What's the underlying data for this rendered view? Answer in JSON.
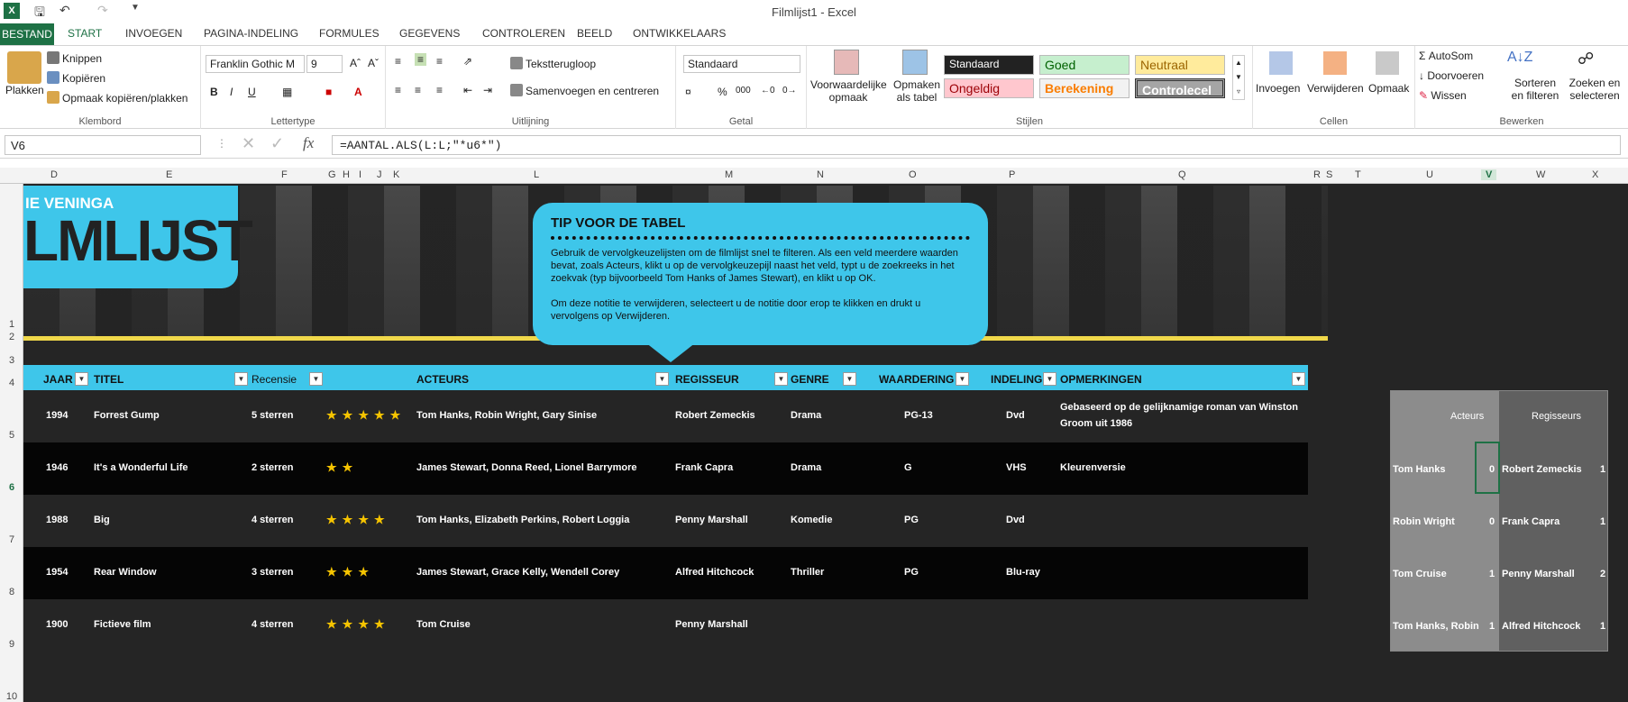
{
  "window": {
    "title": "Filmlijst1 - Excel"
  },
  "tabs": [
    {
      "label": "BESTAND"
    },
    {
      "label": "START"
    },
    {
      "label": "INVOEGEN"
    },
    {
      "label": "PAGINA-INDELING"
    },
    {
      "label": "FORMULES"
    },
    {
      "label": "GEGEVENS"
    },
    {
      "label": "CONTROLEREN"
    },
    {
      "label": "BEELD"
    },
    {
      "label": "ONTWIKKELAARS"
    }
  ],
  "ribbon": {
    "clipboard": {
      "paste": "Plakken",
      "cut": "Knippen",
      "copy": "Kopiëren",
      "format_painter": "Opmaak kopiëren/plakken",
      "label": "Klembord"
    },
    "font": {
      "name": "Franklin Gothic M",
      "size": "9",
      "bold": "B",
      "italic": "I",
      "underline": "U",
      "label": "Lettertype"
    },
    "alignment": {
      "wrap": "Tekstterugloop",
      "merge": "Samenvoegen en centreren",
      "label": "Uitlijning"
    },
    "number": {
      "format": "Standaard",
      "percent": "%",
      "thousands": "000",
      "label": "Getal"
    },
    "styles": {
      "conditional": "Voorwaardelijke opmaak",
      "as_table": "Opmaken als tabel",
      "cells": [
        {
          "text": "Standaard",
          "bg": "#222222",
          "fg": "#ffffff"
        },
        {
          "text": "Goed",
          "bg": "#c6efce",
          "fg": "#006100"
        },
        {
          "text": "Neutraal",
          "bg": "#ffeb9c",
          "fg": "#9c6500"
        },
        {
          "text": "Ongeldig",
          "bg": "#ffc7ce",
          "fg": "#9c0006"
        },
        {
          "text": "Berekening",
          "bg": "#f2f2f2",
          "fg": "#fa7d00"
        },
        {
          "text": "Controlecel",
          "bg": "#a5a5a5",
          "fg": "#ffffff"
        }
      ],
      "label": "Stijlen"
    },
    "cells": {
      "insert": "Invoegen",
      "delete": "Verwijderen",
      "format": "Opmaak",
      "label": "Cellen"
    },
    "editing": {
      "autosum": "AutoSom",
      "fill": "Doorvoeren",
      "clear": "Wissen",
      "sort": "Sorteren en filteren",
      "find": "Zoeken en selecteren",
      "label": "Bewerken"
    }
  },
  "formula_bar": {
    "name_box": "V6",
    "fx": "fx",
    "formula": "=AANTAL.ALS(L:L;\"*u6*\")"
  },
  "columns": [
    "D",
    "E",
    "F",
    "G",
    "H",
    "I",
    "J",
    "K",
    "L",
    "M",
    "N",
    "O",
    "P",
    "Q",
    "R",
    "S",
    "T",
    "U",
    "V",
    "W",
    "X"
  ],
  "rows": [
    "1",
    "2",
    "3",
    "4",
    "5",
    "6",
    "7",
    "8",
    "9",
    "10"
  ],
  "banner": {
    "line1": "IE VENINGA",
    "line2": "LMLIJST"
  },
  "tip": {
    "title": "TIP VOOR DE TABEL",
    "p1": "Gebruik de vervolgkeuzelijsten om de filmlijst snel te filteren. Als een veld meerdere waarden bevat, zoals Acteurs, klikt u op de vervolgkeuzepijl naast het veld, typt u de zoekreeks in het zoekvak (typ bijvoorbeeld Tom Hanks of James Stewart), en klikt u op OK.",
    "p2": "Om deze notitie te verwijderen, selecteert u de notitie door erop te klikken en drukt u vervolgens op Verwijderen."
  },
  "table": {
    "headers": {
      "year": "JAAR",
      "title": "TITEL",
      "review": "Recensie",
      "actors": "ACTEURS",
      "director": "REGISSEUR",
      "genre": "GENRE",
      "rating": "WAARDERING",
      "format": "INDELING",
      "notes": "OPMERKINGEN"
    },
    "rows": [
      {
        "year": "1994",
        "title": "Forrest Gump",
        "review": "5 sterren",
        "stars": 5,
        "actors": "Tom Hanks, Robin Wright, Gary Sinise",
        "director": "Robert Zemeckis",
        "genre": "Drama",
        "rating": "PG-13",
        "format": "Dvd",
        "notes": "Gebaseerd op de gelijknamige roman van Winston",
        "notes2": "Groom uit 1986"
      },
      {
        "year": "1946",
        "title": "It's a Wonderful Life",
        "review": "2 sterren",
        "stars": 2,
        "actors": "James Stewart, Donna Reed, Lionel Barrymore",
        "director": "Frank Capra",
        "genre": "Drama",
        "rating": "G",
        "format": "VHS",
        "notes": "Kleurenversie",
        "notes2": ""
      },
      {
        "year": "1988",
        "title": "Big",
        "review": "4 sterren",
        "stars": 4,
        "actors": "Tom Hanks, Elizabeth Perkins, Robert Loggia",
        "director": "Penny Marshall",
        "genre": "Komedie",
        "rating": "PG",
        "format": "Dvd",
        "notes": "",
        "notes2": ""
      },
      {
        "year": "1954",
        "title": "Rear Window",
        "review": "3 sterren",
        "stars": 3,
        "actors": "James Stewart, Grace Kelly, Wendell Corey",
        "director": "Alfred Hitchcock",
        "genre": "Thriller",
        "rating": "PG",
        "format": "Blu-ray",
        "notes": "",
        "notes2": ""
      },
      {
        "year": "1900",
        "title": "Fictieve film",
        "review": "4 sterren",
        "stars": 4,
        "actors": "Tom Cruise",
        "director": "Penny Marshall",
        "genre": "",
        "rating": "",
        "format": "",
        "notes": "",
        "notes2": ""
      }
    ]
  },
  "side": {
    "h_actors": "Acteurs",
    "h_directors": "Regisseurs",
    "actors": [
      {
        "name": "Tom Hanks",
        "count": "0"
      },
      {
        "name": "Robin Wright",
        "count": "0"
      },
      {
        "name": "Tom Cruise",
        "count": "1"
      },
      {
        "name": "Tom Hanks, Robin",
        "count": "1"
      }
    ],
    "directors": [
      {
        "name": "Robert Zemeckis",
        "count": "1"
      },
      {
        "name": "Frank Capra",
        "count": "1"
      },
      {
        "name": "Penny Marshall",
        "count": "2"
      },
      {
        "name": "Alfred Hitchcock",
        "count": "1"
      }
    ]
  }
}
